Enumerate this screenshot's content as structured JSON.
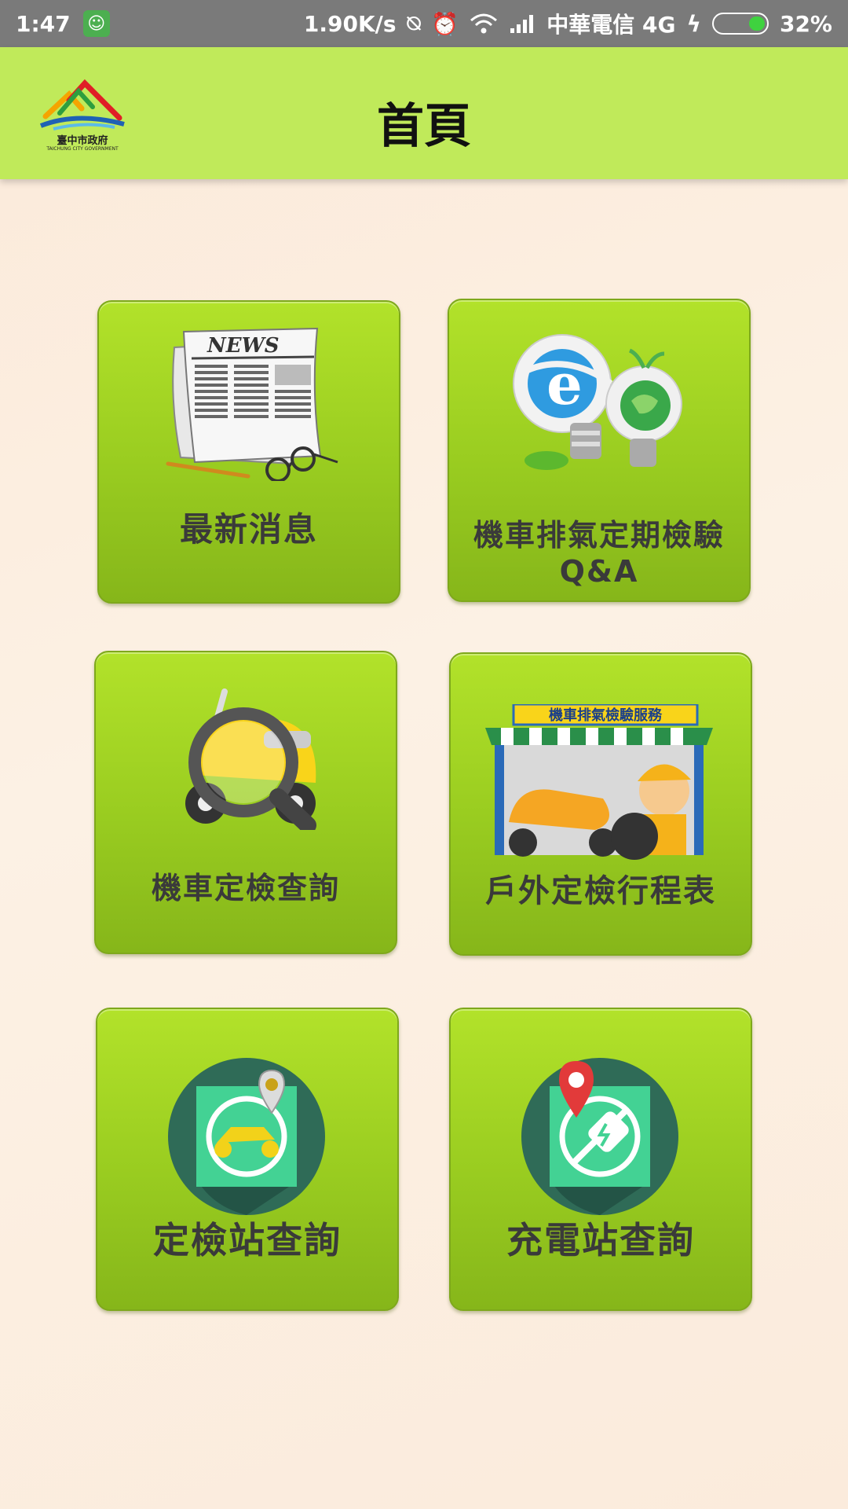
{
  "status_bar": {
    "time": "1:47",
    "speed": "1.90K/s",
    "carrier": "中華電信 4G",
    "battery_text": "32%",
    "battery_level": 0.32,
    "icons": [
      "android-notification-icon",
      "vibrate-off-icon",
      "alarm-icon",
      "wifi-icon",
      "signal-icon",
      "charging-icon",
      "battery-icon"
    ]
  },
  "header": {
    "title": "首頁",
    "logo_text": "臺中市政府",
    "logo_subtext": "TAICHUNG CITY GOVERNMENT"
  },
  "tiles": [
    {
      "label": "最新消息",
      "icon": "newspaper-icon",
      "newspaper_masthead": "NEWS"
    },
    {
      "label_line1": "機車排氣定期檢驗",
      "label_line2": "Q&A",
      "icon": "lightbulb-globe-icon"
    },
    {
      "label": "機車定檢查詢",
      "icon": "scooter-search-icon"
    },
    {
      "label": "戶外定檢行程表",
      "icon": "outdoor-service-booth-icon",
      "banner_text": "機車排氣檢驗服務"
    },
    {
      "label": "定檢站查詢",
      "icon": "inspection-station-map-icon"
    },
    {
      "label": "充電站查詢",
      "icon": "charging-station-map-icon"
    }
  ],
  "colors": {
    "app_bar": "#c0ea5a",
    "tile": "#9fd223",
    "status_bar": "#7a7a7a"
  }
}
